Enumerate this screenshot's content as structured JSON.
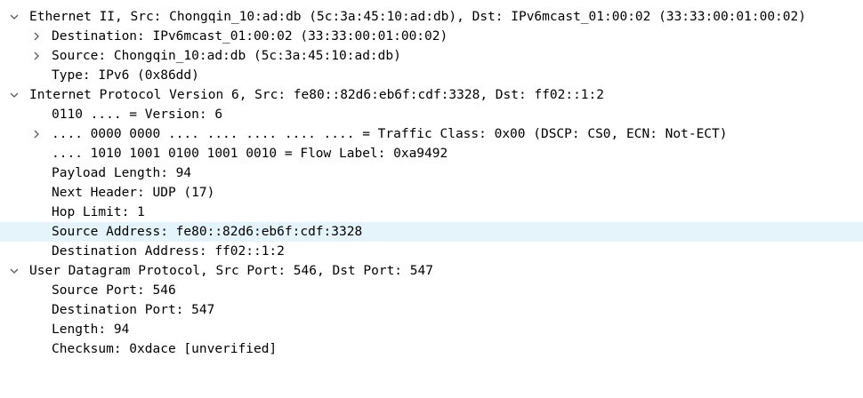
{
  "tree": {
    "ethernet": {
      "summary": "Ethernet II, Src: Chongqin_10:ad:db (5c:3a:45:10:ad:db), Dst: IPv6mcast_01:00:02 (33:33:00:01:00:02)",
      "expanded": true,
      "fields": [
        {
          "text": "Destination: IPv6mcast_01:00:02 (33:33:00:01:00:02)",
          "expandable": true,
          "expanded": false
        },
        {
          "text": "Source: Chongqin_10:ad:db (5c:3a:45:10:ad:db)",
          "expandable": true,
          "expanded": false
        },
        {
          "text": "Type: IPv6 (0x86dd)",
          "expandable": false
        }
      ]
    },
    "ipv6": {
      "summary": "Internet Protocol Version 6, Src: fe80::82d6:eb6f:cdf:3328, Dst: ff02::1:2",
      "expanded": true,
      "fields": [
        {
          "text": "0110 .... = Version: 6",
          "expandable": false
        },
        {
          "text": ".... 0000 0000 .... .... .... .... .... = Traffic Class: 0x00 (DSCP: CS0, ECN: Not-ECT)",
          "expandable": true,
          "expanded": false
        },
        {
          "text": ".... 1010 1001 0100 1001 0010 = Flow Label: 0xa9492",
          "expandable": false
        },
        {
          "text": "Payload Length: 94",
          "expandable": false
        },
        {
          "text": "Next Header: UDP (17)",
          "expandable": false
        },
        {
          "text": "Hop Limit: 1",
          "expandable": false
        },
        {
          "text": "Source Address: fe80::82d6:eb6f:cdf:3328",
          "expandable": false,
          "selected": true
        },
        {
          "text": "Destination Address: ff02::1:2",
          "expandable": false
        }
      ]
    },
    "udp": {
      "summary": "User Datagram Protocol, Src Port: 546, Dst Port: 547",
      "expanded": true,
      "fields": [
        {
          "text": "Source Port: 546",
          "expandable": false
        },
        {
          "text": "Destination Port: 547",
          "expandable": false
        },
        {
          "text": "Length: 94",
          "expandable": false
        },
        {
          "text": "Checksum: 0xdace [unverified]",
          "expandable": false
        }
      ]
    }
  },
  "icons": {
    "expanded": "chevron-down-icon",
    "collapsed": "chevron-right-icon"
  },
  "colors": {
    "selected_row": "#e5f3fb",
    "chevron": "#5a5a5a",
    "text": "#000000"
  }
}
